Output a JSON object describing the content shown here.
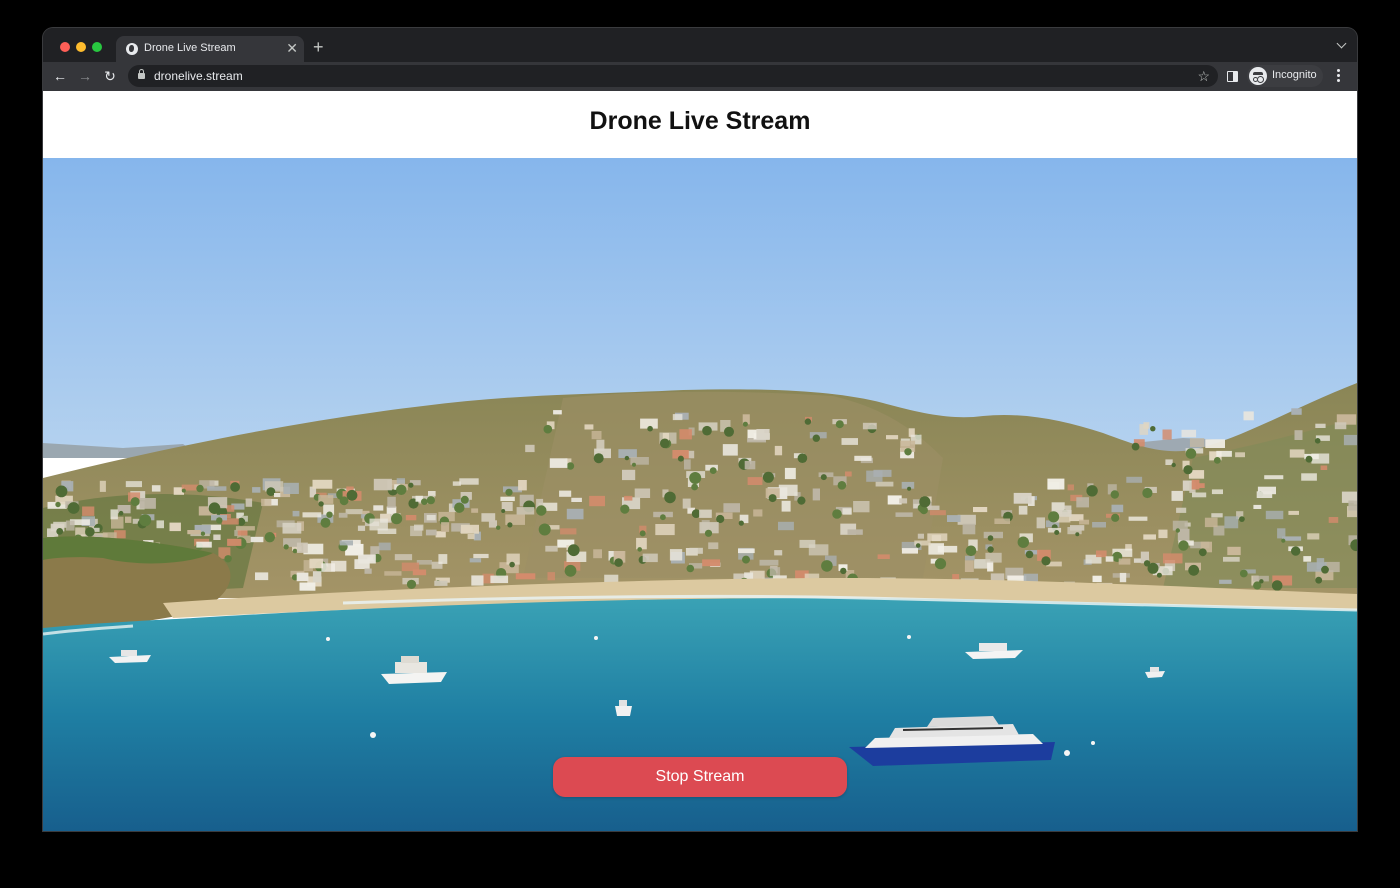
{
  "browser": {
    "tab": {
      "title": "Drone Live Stream",
      "favicon": "globe-icon",
      "close_glyph": "✕"
    },
    "new_tab_glyph": "+",
    "toolbar": {
      "back_glyph": "←",
      "forward_glyph": "→",
      "reload_glyph": "↻",
      "url": "dronelive.stream",
      "bookmark_glyph": "☆",
      "profile_label": "Incognito"
    }
  },
  "page": {
    "title": "Drone Live Stream",
    "stream": {
      "content": "drone-video-frame",
      "stop_button_label": "Stop Stream",
      "stop_button_color": "#dc4a52"
    }
  }
}
